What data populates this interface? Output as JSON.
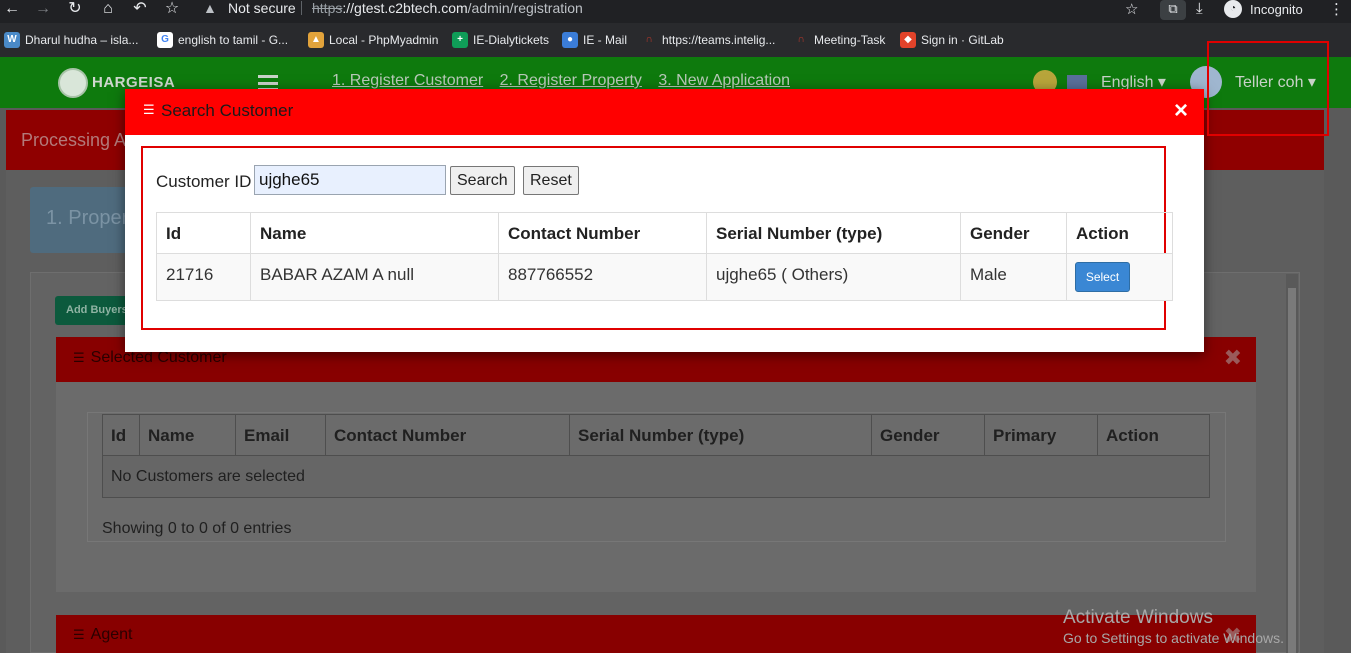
{
  "browser": {
    "security_label": "Not secure",
    "url_protocol": "https",
    "url_host": "://gtest.c2btech.com",
    "url_path": "/admin/registration",
    "incognito_label": "Incognito",
    "bookmarks": [
      {
        "label": "Dharul hudha – isla...",
        "icon": "wordpress-icon",
        "color": "#4a8ac8"
      },
      {
        "label": "english to tamil - G...",
        "icon": "google-icon",
        "color": "#4285f4"
      },
      {
        "label": "Local - PhpMyadmin",
        "icon": "phpmyadmin-icon",
        "color": "#e2a33b"
      },
      {
        "label": "IE-Dialytickets",
        "icon": "sheets-icon",
        "color": "#0f9d58"
      },
      {
        "label": "IE - Mail",
        "icon": "globe-icon",
        "color": "#3b7dd8"
      },
      {
        "label": "https://teams.intelig...",
        "icon": "teams-icon",
        "color": "#c0392b"
      },
      {
        "label": "Meeting-Task",
        "icon": "task-icon",
        "color": "#c0392b"
      },
      {
        "label": "Sign in · GitLab",
        "icon": "gitlab-icon",
        "color": "#e2432a"
      }
    ]
  },
  "app": {
    "brand_name": "HARGEISA",
    "steps": [
      "1. Register Customer",
      "2. Register Property",
      "3. New Application"
    ],
    "language": "English ▾",
    "user": "Teller coh ▾",
    "processing_title": "Processing A",
    "property_step": "1. Propert",
    "add_buyers_label": "Add Buyers",
    "selected_customer_title": "Selected Customer",
    "selected_columns": [
      "Id",
      "Name",
      "Email",
      "Contact Number",
      "Serial Number (type)",
      "Gender",
      "Primary",
      "Action"
    ],
    "no_customers_text": "No Customers are selected",
    "showing_text": "Showing 0 to 0 of 0 entries",
    "agent_title": "Agent"
  },
  "modal": {
    "title": "Search Customer",
    "close_label": "×",
    "customer_id_label": "Customer ID",
    "customer_id_value": "ujghe65",
    "search_label": "Search",
    "reset_label": "Reset",
    "columns": [
      "Id",
      "Name",
      "Contact Number",
      "Serial Number (type)",
      "Gender",
      "Action"
    ],
    "rows": [
      {
        "id": "21716",
        "name": "BABAR AZAM A null",
        "contact": "887766552",
        "serial": "ujghe65 ( Others)",
        "gender": "Male",
        "action": "Select"
      }
    ]
  },
  "watermark": {
    "line1": "Activate Windows",
    "line2": "Go to Settings to activate Windows."
  },
  "colors": {
    "modal_header": "#ff0000",
    "nav_green": "#0e7a0d",
    "select_button": "#3a87d4"
  }
}
